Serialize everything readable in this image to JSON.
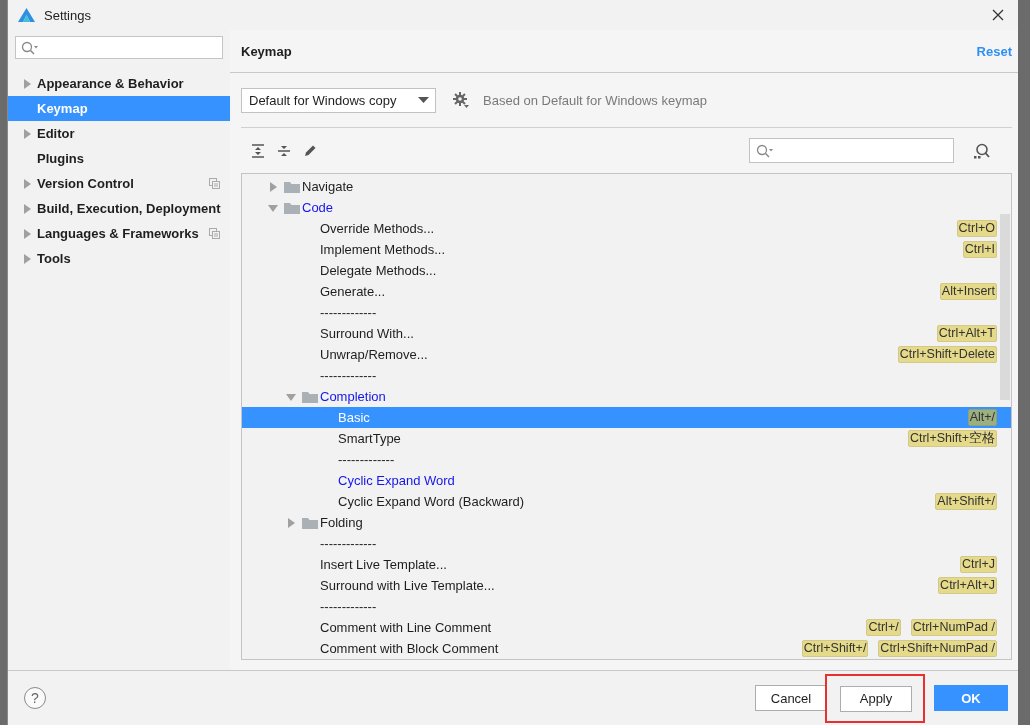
{
  "window": {
    "title": "Settings"
  },
  "sidebar": {
    "items": [
      {
        "label": "Appearance & Behavior",
        "expandable": true,
        "selected": false,
        "project_level": false
      },
      {
        "label": "Keymap",
        "expandable": false,
        "selected": true,
        "project_level": false
      },
      {
        "label": "Editor",
        "expandable": true,
        "selected": false,
        "project_level": false
      },
      {
        "label": "Plugins",
        "expandable": false,
        "selected": false,
        "project_level": false
      },
      {
        "label": "Version Control",
        "expandable": true,
        "selected": false,
        "project_level": true
      },
      {
        "label": "Build, Execution, Deployment",
        "expandable": true,
        "selected": false,
        "project_level": false
      },
      {
        "label": "Languages & Frameworks",
        "expandable": true,
        "selected": false,
        "project_level": true
      },
      {
        "label": "Tools",
        "expandable": true,
        "selected": false,
        "project_level": false
      }
    ]
  },
  "panel": {
    "title": "Keymap",
    "reset": "Reset",
    "keymap_select": {
      "value": "Default for Windows copy"
    },
    "based_on": "Based on Default for Windows keymap"
  },
  "tree": [
    {
      "kind": "folder",
      "label": "Navigate",
      "expanded": false,
      "modified": false,
      "selected": false
    },
    {
      "kind": "folder",
      "label": "Code",
      "expanded": true,
      "modified": true,
      "selected": false,
      "children": [
        {
          "kind": "action",
          "label": "Override Methods...",
          "shortcuts": [
            "Ctrl+O"
          ],
          "modified": false,
          "selected": false
        },
        {
          "kind": "action",
          "label": "Implement Methods...",
          "shortcuts": [
            "Ctrl+I"
          ],
          "modified": false,
          "selected": false
        },
        {
          "kind": "action",
          "label": "Delegate Methods...",
          "modified": false,
          "selected": false
        },
        {
          "kind": "action",
          "label": "Generate...",
          "shortcuts": [
            "Alt+Insert"
          ],
          "modified": false,
          "selected": false
        },
        {
          "kind": "separator",
          "label": "-------------"
        },
        {
          "kind": "action",
          "label": "Surround With...",
          "shortcuts": [
            "Ctrl+Alt+T"
          ],
          "modified": false,
          "selected": false
        },
        {
          "kind": "action",
          "label": "Unwrap/Remove...",
          "shortcuts": [
            "Ctrl+Shift+Delete"
          ],
          "modified": false,
          "selected": false
        },
        {
          "kind": "separator",
          "label": "-------------"
        },
        {
          "kind": "folder",
          "label": "Completion",
          "expanded": true,
          "modified": true,
          "selected": false,
          "children": [
            {
              "kind": "action",
              "label": "Basic",
              "shortcuts": [
                "Alt+/"
              ],
              "modified": false,
              "selected": true
            },
            {
              "kind": "action",
              "label": "SmartType",
              "shortcuts": [
                "Ctrl+Shift+空格"
              ],
              "modified": false,
              "selected": false
            },
            {
              "kind": "separator",
              "label": "-------------"
            },
            {
              "kind": "action",
              "label": "Cyclic Expand Word",
              "modified": true,
              "selected": false
            },
            {
              "kind": "action",
              "label": "Cyclic Expand Word (Backward)",
              "shortcuts": [
                "Alt+Shift+/"
              ],
              "modified": false,
              "selected": false
            }
          ]
        },
        {
          "kind": "folder",
          "label": "Folding",
          "expanded": false,
          "modified": false,
          "selected": false
        },
        {
          "kind": "separator",
          "label": "-------------"
        },
        {
          "kind": "action",
          "label": "Insert Live Template...",
          "shortcuts": [
            "Ctrl+J"
          ],
          "modified": false,
          "selected": false
        },
        {
          "kind": "action",
          "label": "Surround with Live Template...",
          "shortcuts": [
            "Ctrl+Alt+J"
          ],
          "modified": false,
          "selected": false
        },
        {
          "kind": "separator",
          "label": "-------------"
        },
        {
          "kind": "action",
          "label": "Comment with Line Comment",
          "shortcuts": [
            "Ctrl+/",
            "Ctrl+NumPad /"
          ],
          "modified": false,
          "selected": false
        },
        {
          "kind": "action",
          "label": "Comment with Block Comment",
          "shortcuts": [
            "Ctrl+Shift+/",
            "Ctrl+Shift+NumPad /"
          ],
          "modified": false,
          "selected": false
        }
      ]
    }
  ],
  "footer": {
    "help": "?",
    "buttons": [
      {
        "label": "Cancel",
        "kind": "default",
        "highlighted": false
      },
      {
        "label": "Apply",
        "kind": "default",
        "highlighted": true
      },
      {
        "label": "OK",
        "kind": "primary",
        "highlighted": false
      }
    ]
  }
}
